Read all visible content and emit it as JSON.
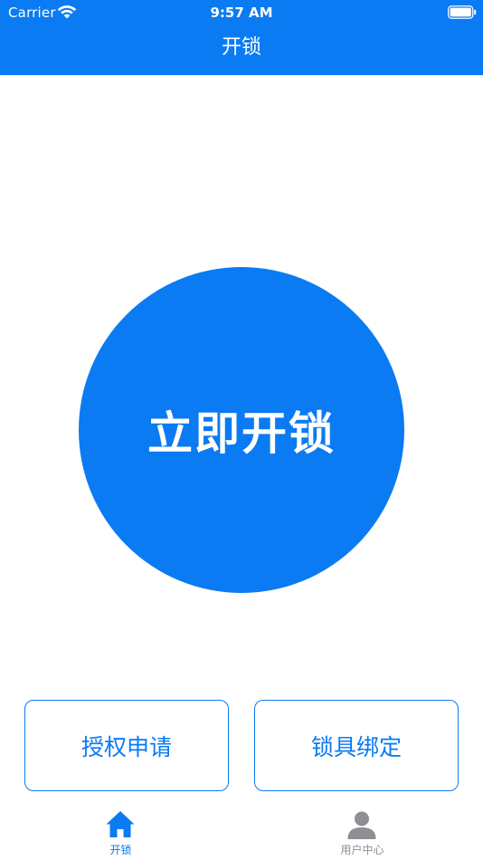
{
  "status_bar": {
    "carrier": "Carrier",
    "time": "9:57 AM"
  },
  "header": {
    "title": "开锁",
    "background_color": "#0a7bf2"
  },
  "main": {
    "unlock_button_label": "立即开锁",
    "accent_color": "#0a7bf2"
  },
  "actions": {
    "authorize_label": "授权申请",
    "bind_lock_label": "锁具绑定"
  },
  "tabbar": {
    "items": [
      {
        "label": "开锁",
        "icon": "home-icon",
        "active": true,
        "color": "#0a7bf2"
      },
      {
        "label": "用户中心",
        "icon": "user-icon",
        "active": false,
        "color": "#8e8e93"
      }
    ]
  }
}
